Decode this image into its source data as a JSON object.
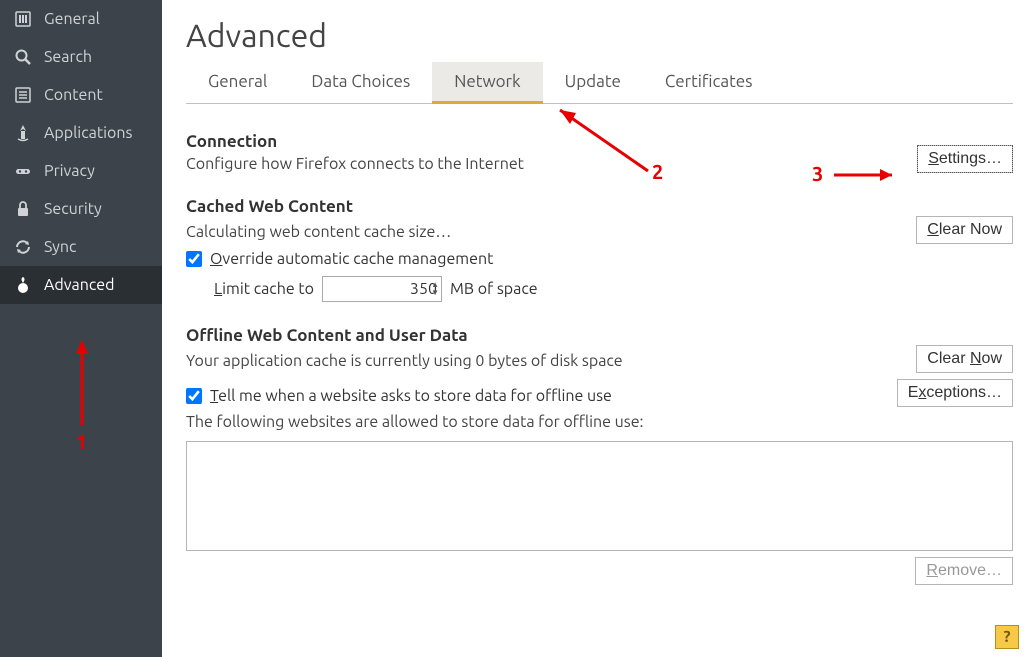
{
  "sidebar": {
    "items": [
      {
        "label": "General"
      },
      {
        "label": "Search"
      },
      {
        "label": "Content"
      },
      {
        "label": "Applications"
      },
      {
        "label": "Privacy"
      },
      {
        "label": "Security"
      },
      {
        "label": "Sync"
      },
      {
        "label": "Advanced"
      }
    ]
  },
  "main": {
    "title": "Advanced",
    "tabs": [
      {
        "label": "General"
      },
      {
        "label": "Data Choices"
      },
      {
        "label": "Network"
      },
      {
        "label": "Update"
      },
      {
        "label": "Certificates"
      }
    ],
    "connection": {
      "heading": "Connection",
      "desc": "Configure how Firefox connects to the Internet",
      "settings_btn": "Settings…"
    },
    "cached": {
      "heading": "Cached Web Content",
      "status": "Calculating web content cache size…",
      "clear_btn": "Clear Now",
      "override_label": "Override automatic cache management",
      "override_checked": true,
      "limit_prefix": "Limit cache to",
      "limit_value": "350",
      "limit_suffix": "MB of space"
    },
    "offline": {
      "heading": "Offline Web Content and User Data",
      "status": "Your application cache is currently using 0 bytes of disk space",
      "clear_btn": "Clear Now",
      "tell_label": "Tell me when a website asks to store data for offline use",
      "tell_checked": true,
      "exceptions_btn": "Exceptions…",
      "allowed_label": "The following websites are allowed to store data for offline use:",
      "remove_btn": "Remove…"
    },
    "help": "?",
    "annotations": {
      "n1": "1",
      "n2": "2",
      "n3": "3"
    }
  }
}
